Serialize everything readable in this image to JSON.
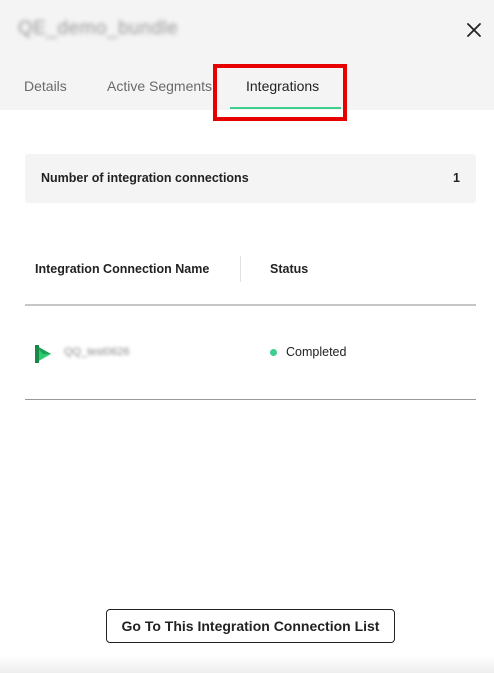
{
  "dialog": {
    "title": "QE_demo_bundle",
    "close_icon": "close-icon"
  },
  "tabs": [
    {
      "label": "Details",
      "active": false
    },
    {
      "label": "Active Segments",
      "active": false
    },
    {
      "label": "Integrations",
      "active": true
    }
  ],
  "summary": {
    "label": "Number of integration connections",
    "count": "1"
  },
  "table": {
    "columns": [
      "Integration Connection Name",
      "Status"
    ],
    "rows": [
      {
        "icon": "play-icon",
        "name": "QQ_test0626",
        "status": "Completed",
        "status_color": "#3ccf8e"
      }
    ]
  },
  "actions": {
    "go_to_list_label": "Go To This Integration Connection List"
  },
  "colors": {
    "accent_green": "#3ccf8e",
    "highlight_red": "#e60000"
  }
}
